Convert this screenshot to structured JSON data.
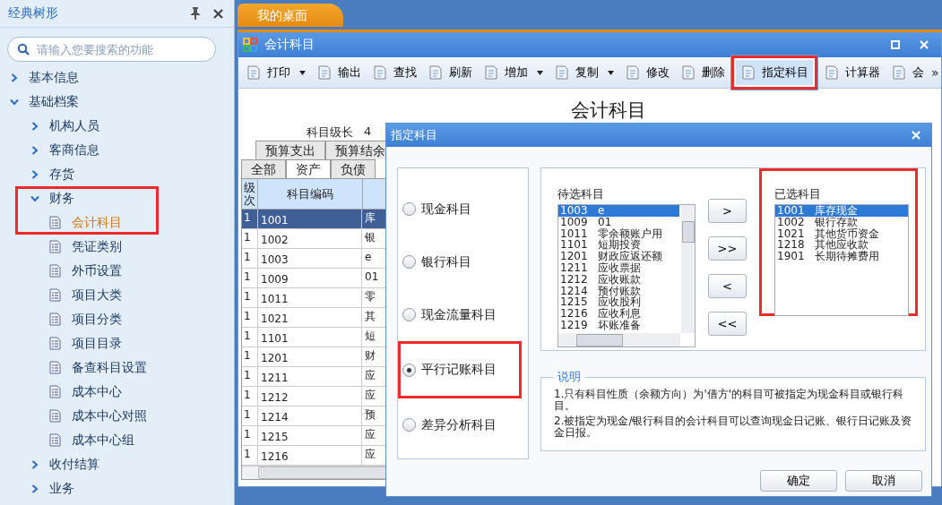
{
  "sidebar": {
    "title": "经典树形",
    "search": {
      "placeholder": "请输入您要搜索的功能"
    },
    "tree": [
      {
        "label": "基本信息",
        "expanded": false
      },
      {
        "label": "基础档案",
        "expanded": true,
        "children": [
          {
            "label": "机构人员",
            "expanded": false
          },
          {
            "label": "客商信息",
            "expanded": false
          },
          {
            "label": "存货",
            "expanded": false
          },
          {
            "label": "财务",
            "expanded": true,
            "highlighted": true,
            "children": [
              {
                "label": "会计科目",
                "selected": true
              },
              {
                "label": "凭证类别",
                "selected": false
              },
              {
                "label": "外币设置",
                "selected": false
              },
              {
                "label": "项目大类",
                "selected": false
              },
              {
                "label": "项目分类",
                "selected": false
              },
              {
                "label": "项目目录",
                "selected": false
              },
              {
                "label": "备查科目设置",
                "selected": false
              },
              {
                "label": "成本中心",
                "selected": false
              },
              {
                "label": "成本中心对照",
                "selected": false
              },
              {
                "label": "成本中心组",
                "selected": false
              }
            ]
          },
          {
            "label": "收付结算",
            "expanded": false
          },
          {
            "label": "业务",
            "expanded": false
          }
        ]
      }
    ]
  },
  "tabs": [
    {
      "label": "我的桌面",
      "selected": true
    }
  ],
  "window": {
    "title": "会计科目",
    "toolbar": [
      {
        "label": "打印",
        "dropdown": true,
        "active": false,
        "highlighted": false
      },
      {
        "label": "输出",
        "dropdown": false,
        "active": false,
        "highlighted": false
      },
      {
        "label": "查找",
        "dropdown": false,
        "active": false,
        "highlighted": false
      },
      {
        "label": "刷新",
        "dropdown": false,
        "active": false,
        "highlighted": false
      },
      {
        "label": "增加",
        "dropdown": true,
        "active": false,
        "highlighted": false
      },
      {
        "label": "复制",
        "dropdown": true,
        "active": false,
        "highlighted": false
      },
      {
        "label": "修改",
        "dropdown": false,
        "active": false,
        "highlighted": false
      },
      {
        "label": "删除",
        "dropdown": false,
        "active": false,
        "highlighted": false
      },
      {
        "label": "指定科目",
        "dropdown": false,
        "active": true,
        "highlighted": true
      },
      {
        "label": "计算器",
        "dropdown": false,
        "active": false,
        "highlighted": false
      },
      {
        "label": "会",
        "dropdown": false,
        "active": false,
        "highlighted": false
      }
    ],
    "overflow": "»",
    "heading": "会计科目",
    "level_length": {
      "label": "科目级长",
      "value": "4"
    },
    "tab_rows": [
      [
        {
          "label": "预算支出",
          "selected": false
        },
        {
          "label": "预算结余",
          "selected": false
        }
      ],
      [
        {
          "label": "全部",
          "selected": false
        },
        {
          "label": "资产",
          "selected": true
        },
        {
          "label": "负债",
          "selected": false
        }
      ]
    ],
    "table": {
      "columns": [
        "级次",
        "科目编码"
      ],
      "rows": [
        {
          "level": "1",
          "code": "1001",
          "column_3": "库",
          "selected": true
        },
        {
          "level": "1",
          "code": "1002",
          "column_3": "银",
          "selected": false
        },
        {
          "level": "1",
          "code": "1003",
          "column_3": "e",
          "selected": false
        },
        {
          "level": "1",
          "code": "1009",
          "column_3": "01",
          "selected": false
        },
        {
          "level": "1",
          "code": "1011",
          "column_3": "零",
          "selected": false
        },
        {
          "level": "1",
          "code": "1021",
          "column_3": "其",
          "selected": false
        },
        {
          "level": "1",
          "code": "1101",
          "column_3": "短",
          "selected": false
        },
        {
          "level": "1",
          "code": "1201",
          "column_3": "财",
          "selected": false
        },
        {
          "level": "1",
          "code": "1211",
          "column_3": "应",
          "selected": false
        },
        {
          "level": "1",
          "code": "1212",
          "column_3": "应",
          "selected": false
        },
        {
          "level": "1",
          "code": "1214",
          "column_3": "预",
          "selected": false
        },
        {
          "level": "1",
          "code": "1215",
          "column_3": "应",
          "selected": false
        },
        {
          "level": "1",
          "code": "1216",
          "column_3": "应",
          "selected": false
        }
      ]
    }
  },
  "dialog": {
    "title": "指定科目",
    "options": [
      {
        "label": "现金科目",
        "selected": false,
        "highlighted": false
      },
      {
        "label": "银行科目",
        "selected": false,
        "highlighted": false
      },
      {
        "label": "现金流量科目",
        "selected": false,
        "highlighted": false
      },
      {
        "label": "平行记账科目",
        "selected": true,
        "highlighted": true
      },
      {
        "label": "差异分析科目",
        "selected": false,
        "highlighted": false
      }
    ],
    "available": {
      "title": "待选科目",
      "items": [
        {
          "code": "1003",
          "name": "e",
          "selected": true
        },
        {
          "code": "1009",
          "name": "01",
          "selected": false
        },
        {
          "code": "1011",
          "name": "零余额账户用",
          "selected": false
        },
        {
          "code": "1101",
          "name": "短期投资",
          "selected": false
        },
        {
          "code": "1201",
          "name": "财政应返还额",
          "selected": false
        },
        {
          "code": "1211",
          "name": "应收票据",
          "selected": false
        },
        {
          "code": "1212",
          "name": "应收账款",
          "selected": false
        },
        {
          "code": "1214",
          "name": "预付账款",
          "selected": false
        },
        {
          "code": "1215",
          "name": "应收股利",
          "selected": false
        },
        {
          "code": "1216",
          "name": "应收利息",
          "selected": false
        },
        {
          "code": "1219",
          "name": "坏账准备",
          "selected": false
        }
      ]
    },
    "chosen": {
      "title": "已选科目",
      "highlighted": true,
      "items": [
        {
          "code": "1001",
          "name": "库存现金",
          "selected": true
        },
        {
          "code": "1002",
          "name": "银行存款",
          "selected": false
        },
        {
          "code": "1021",
          "name": "其他货币资金",
          "selected": false
        },
        {
          "code": "1218",
          "name": "其他应收款",
          "selected": false
        },
        {
          "code": "1901",
          "name": "长期待摊费用",
          "selected": false
        }
      ]
    },
    "move_buttons": [
      ">",
      ">>",
      "<",
      "<<"
    ],
    "note": {
      "title": "说明",
      "paragraphs": [
        "1.只有科目性质（余额方向）为'借方'的科目可被指定为现金科目或银行科目。",
        "2.被指定为现金/银行科目的会计科目可以查询现金日记账、银行日记账及资金日报。"
      ]
    },
    "buttons": [
      "确定",
      "取消"
    ]
  }
}
